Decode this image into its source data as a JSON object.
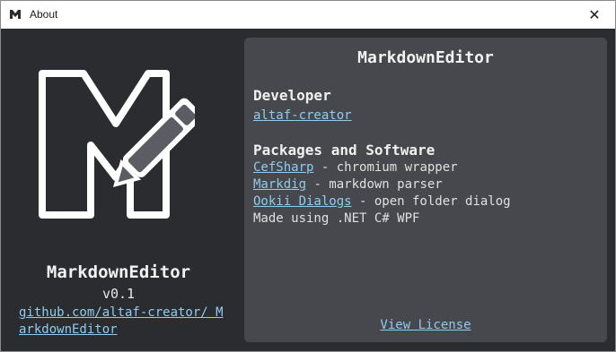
{
  "window": {
    "title": "About",
    "close_glyph": "✕"
  },
  "left": {
    "app_name": "MarkdownEditor",
    "version": "v0.1",
    "repo_link": "github.com/altaf-creator/ MarkdownEditor"
  },
  "panel": {
    "title": "MarkdownEditor",
    "developer_heading": "Developer",
    "developer_link": "altaf-creator",
    "packages_heading": "Packages and Software",
    "packages": [
      {
        "name": "CefSharp",
        "desc": " - chromium wrapper"
      },
      {
        "name": "Markdig",
        "desc": " - markdown parser"
      },
      {
        "name": "Ookii Dialogs",
        "desc": " - open folder dialog"
      }
    ],
    "made_using": "Made using .NET C# WPF",
    "license_link": "View License"
  },
  "colors": {
    "background": "#2b2c2f",
    "panel": "#47484d",
    "link": "#8ecdf0",
    "text": "#f2f2f2"
  },
  "icons": {
    "app_icon": "markdown-pencil-icon",
    "close": "close-icon"
  }
}
